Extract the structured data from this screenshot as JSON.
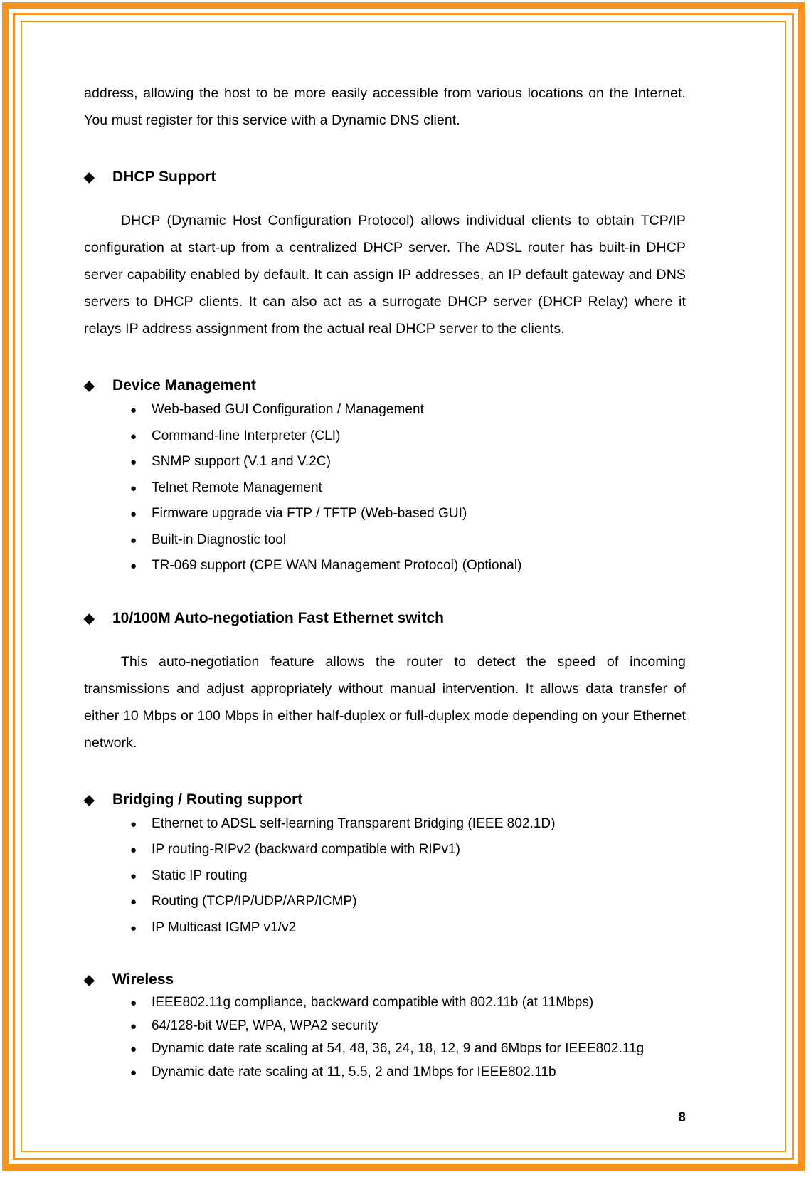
{
  "page": {
    "number": "8",
    "border_color": "#F7941E"
  },
  "icons": {
    "diamond": "◆",
    "bullet": "●"
  },
  "intro_paragraph": "address, allowing the host to be more easily accessible from various locations on the Internet. You must register for this service with a Dynamic DNS client.",
  "sections": [
    {
      "heading": "DHCP Support",
      "paragraph": "DHCP (Dynamic Host Configuration Protocol) allows individual clients to obtain TCP/IP configuration at start-up from a centralized DHCP server. The ADSL router has built-in DHCP server capability enabled by default. It can assign IP addresses, an IP default gateway and DNS servers to DHCP clients. It can also act as a surrogate DHCP server (DHCP Relay) where it relays IP address assignment from the actual real DHCP server to the clients.",
      "bullets": []
    },
    {
      "heading": "Device Management",
      "paragraph": "",
      "bullets": [
        "Web-based GUI Configuration / Management",
        "Command-line Interpreter (CLI)",
        "SNMP support (V.1 and V.2C)",
        "Telnet Remote Management",
        "Firmware upgrade via FTP / TFTP (Web-based GUI)",
        "Built-in Diagnostic tool",
        "TR-069 support (CPE WAN Management Protocol) (Optional)"
      ]
    },
    {
      "heading": "10/100M Auto-negotiation Fast Ethernet switch",
      "paragraph": "This auto-negotiation feature allows the router to detect the speed of incoming transmissions and adjust appropriately without manual intervention. It allows data transfer of either 10 Mbps or 100 Mbps in either half-duplex or full-duplex mode depending on your Ethernet network.",
      "bullets": []
    },
    {
      "heading": "Bridging / Routing support",
      "paragraph": "",
      "bullets": [
        "Ethernet to ADSL self-learning Transparent Bridging (IEEE 802.1D)",
        "IP routing-RIPv2 (backward compatible with RIPv1)",
        "Static IP routing",
        "Routing (TCP/IP/UDP/ARP/ICMP)",
        "IP Multicast IGMP v1/v2"
      ]
    },
    {
      "heading": "Wireless",
      "paragraph": "",
      "bullets": [
        "IEEE802.11g compliance, backward compatible with 802.11b (at 11Mbps)",
        "64/128-bit WEP, WPA, WPA2 security",
        "Dynamic date rate scaling at 54, 48, 36, 24, 18, 12, 9 and 6Mbps for IEEE802.11g",
        "Dynamic date rate scaling at 11, 5.5, 2 and 1Mbps for IEEE802.11b"
      ]
    }
  ]
}
